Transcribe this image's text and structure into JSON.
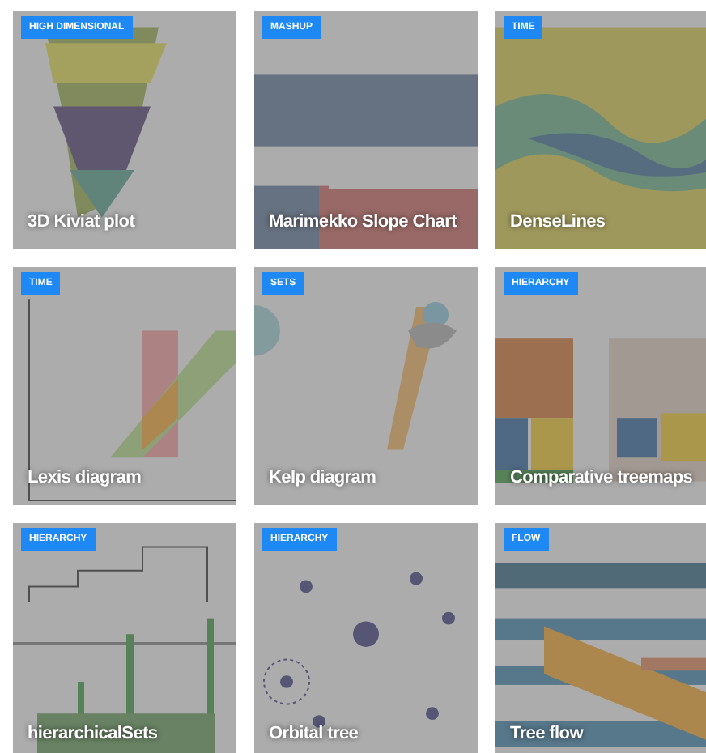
{
  "cards": [
    {
      "tag": "HIGH DIMENSIONAL",
      "title": "3D Kiviat plot"
    },
    {
      "tag": "MASHUP",
      "title": "Marimekko Slope Chart"
    },
    {
      "tag": "TIME",
      "title": "DenseLines"
    },
    {
      "tag": "TIME",
      "title": "Lexis diagram"
    },
    {
      "tag": "SETS",
      "title": "Kelp diagram"
    },
    {
      "tag": "HIERARCHY",
      "title": "Comparative treemaps"
    },
    {
      "tag": "HIERARCHY",
      "title": "hierarchicalSets"
    },
    {
      "tag": "HIERARCHY",
      "title": "Orbital tree"
    },
    {
      "tag": "FLOW",
      "title": "Tree flow"
    }
  ]
}
